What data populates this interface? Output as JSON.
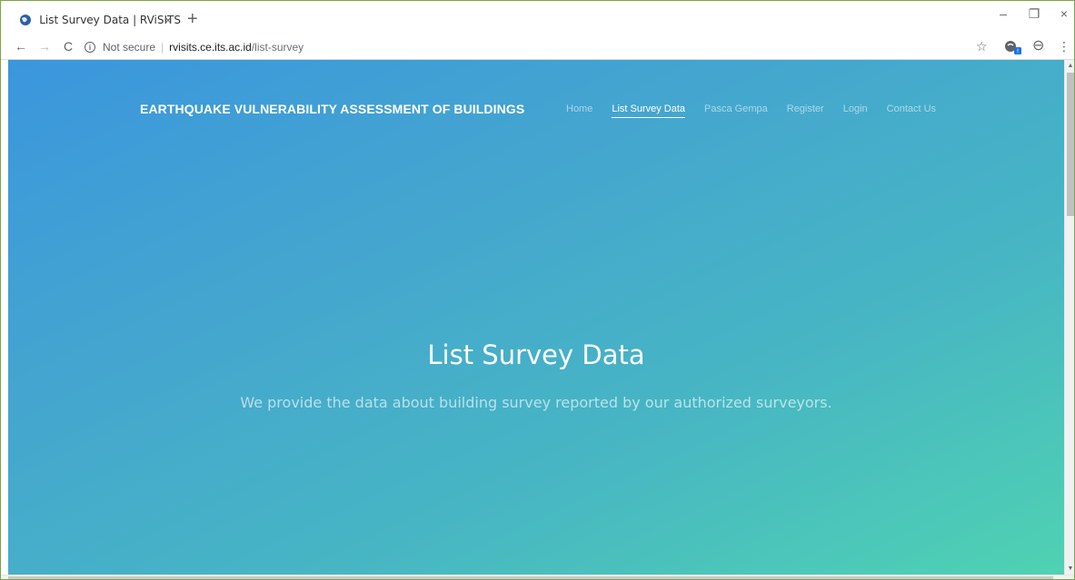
{
  "browser": {
    "tab_title": "List Survey Data | RViSITS",
    "tab_close": "×",
    "new_tab": "+",
    "window_minimize": "–",
    "window_restore": "❐",
    "window_close": "×",
    "back": "←",
    "forward": "→",
    "reload": "C",
    "security_info": "i",
    "security_label": "Not secure",
    "separator": "|",
    "url_domain": "rvisits.ce.its.ac.id",
    "url_path": "/list-survey",
    "bookmark_icon": "☆",
    "profile_icon": "⊖",
    "menu_icon": "⋮"
  },
  "page": {
    "brand": "EARTHQUAKE VULNERABILITY ASSESSMENT OF BUILDINGS",
    "nav": [
      {
        "label": "Home"
      },
      {
        "label": "List Survey Data"
      },
      {
        "label": "Pasca Gempa"
      },
      {
        "label": "Register"
      },
      {
        "label": "Login"
      },
      {
        "label": "Contact Us"
      }
    ],
    "active_nav": "List Survey Data",
    "hero_title": "List Survey Data",
    "hero_subtitle": "We provide the data about building survey reported by our authorized surveyors."
  },
  "colors": {
    "gradient_start": "#3b96dd",
    "gradient_end": "#4fd2b2",
    "frame": "#7da343"
  },
  "icons": {
    "favicon": "globe-icon",
    "extension": "extension-icon",
    "profile": "account-icon"
  }
}
